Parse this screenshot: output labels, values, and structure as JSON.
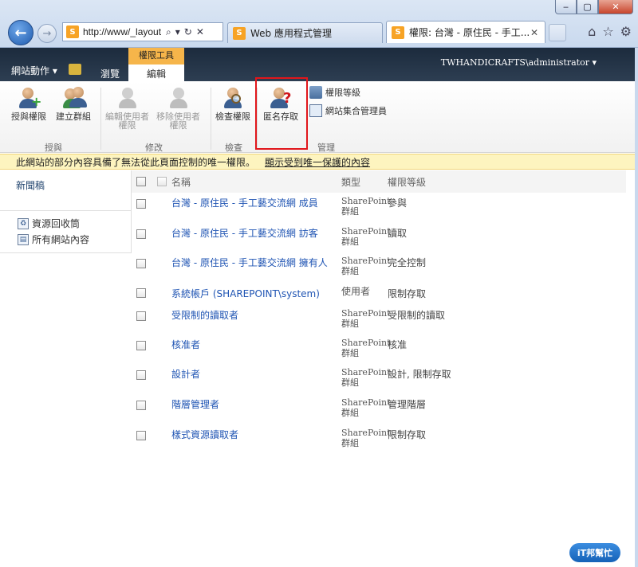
{
  "browser": {
    "address_url": "http://www/_layout",
    "tabs": [
      {
        "label": "Web 應用程式管理"
      },
      {
        "label": "權限: 台灣 - 原住民 - 手工..."
      }
    ]
  },
  "ribbon": {
    "site_actions": "網站動作",
    "context_label": "權限工具",
    "tabs": [
      "瀏覽",
      "編輯"
    ],
    "user": "TWHANDICRAFTS\\administrator",
    "buttons": {
      "grant": "授與權限",
      "create_group": "建立群組",
      "edit_user_l1": "編輯使用者",
      "edit_user_l2": "權限",
      "remove_user_l1": "移除使用者",
      "remove_user_l2": "權限",
      "check": "檢查權限",
      "anonymous": "匿名存取",
      "levels": "權限等級",
      "site_admins": "網站集合管理員"
    },
    "groups": [
      "授與",
      "修改",
      "檢查",
      "管理"
    ]
  },
  "notice": {
    "text": "此網站的部分內容具備了無法從此頁面控制的唯一權限。",
    "link": "顯示受到唯一保護的內容"
  },
  "leftnav": {
    "top_link": "新聞稿",
    "items": [
      "資源回收筒",
      "所有網站內容"
    ]
  },
  "table": {
    "headers": {
      "name": "名稱",
      "type": "類型",
      "level": "權限等級"
    },
    "rows": [
      {
        "name": "台灣 - 原住民 - 手工藝交流網 成員",
        "type_l1": "SharePoint",
        "type_l2": "群組",
        "level": "參與"
      },
      {
        "name": "台灣 - 原住民 - 手工藝交流網 訪客",
        "type_l1": "SharePoint",
        "type_l2": "群組",
        "level": "讀取"
      },
      {
        "name": "台灣 - 原住民 - 手工藝交流網 擁有人",
        "type_l1": "SharePoint",
        "type_l2": "群組",
        "level": "完全控制"
      },
      {
        "name": "系統帳戶 (SHAREPOINT\\system)",
        "type_l1": "使用者",
        "type_l2": "",
        "level": "限制存取"
      },
      {
        "name": "受限制的讀取者",
        "type_l1": "SharePoint",
        "type_l2": "群組",
        "level": "受限制的讀取"
      },
      {
        "name": "核准者",
        "type_l1": "SharePoint",
        "type_l2": "群組",
        "level": "核准"
      },
      {
        "name": "設計者",
        "type_l1": "SharePoint",
        "type_l2": "群組",
        "level": "設計, 限制存取"
      },
      {
        "name": "階層管理者",
        "type_l1": "SharePoint",
        "type_l2": "群組",
        "level": "管理階層"
      },
      {
        "name": "樣式資源讀取者",
        "type_l1": "SharePoint",
        "type_l2": "群組",
        "level": "限制存取"
      }
    ]
  },
  "watermark": "iT邦幫忙"
}
